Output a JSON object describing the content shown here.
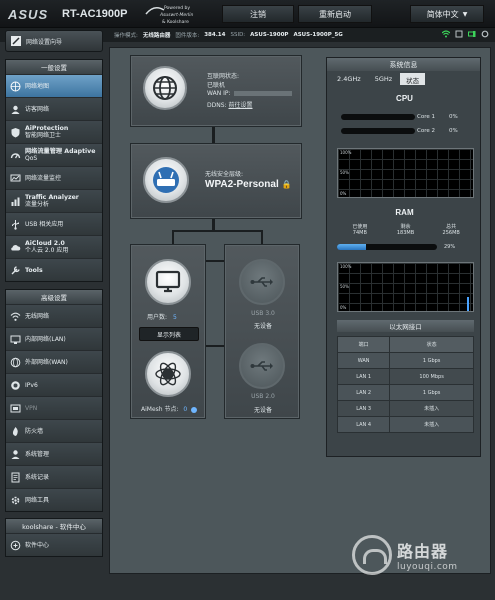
{
  "header": {
    "brand": "ASUS",
    "model": "RT-AC1900P",
    "powered_by": "Powered by Asuswrt-Merlin & Koolshare",
    "logout": "注销",
    "reboot": "重新启动",
    "language": "简体中文"
  },
  "status_bar": {
    "mode_label": "操作模式:",
    "mode_value": "无线路由器",
    "firmware_label": "固件版本:",
    "firmware_value": "384.14",
    "ssid_label": "SSID:",
    "ssid_values": [
      "ASUS-1900P",
      "ASUS-1900P_5G"
    ]
  },
  "sidebar": {
    "quick_setup": "网络设置向导",
    "general_header": "一般设置",
    "general_items": [
      {
        "label": "网络地图",
        "icon": "network-map-icon"
      },
      {
        "label": "访客网络",
        "icon": "guest-network-icon"
      },
      {
        "label": "AiProtection",
        "sub": "智能网络卫士",
        "icon": "aiprotection-icon"
      },
      {
        "label": "网络流量管理 Adaptive",
        "sub": "QoS",
        "icon": "qos-icon"
      },
      {
        "label": "网络流量监控",
        "icon": "traffic-monitor-icon"
      },
      {
        "label": "Traffic Analyzer",
        "sub": "流量分析",
        "icon": "traffic-analyzer-icon"
      },
      {
        "label": "USB 相关应用",
        "icon": "usb-apps-icon"
      },
      {
        "label": "AiCloud 2.0",
        "sub": "个人云 2.0 应用",
        "icon": "aicloud-icon"
      },
      {
        "label": "Tools",
        "icon": "tools-icon"
      }
    ],
    "advanced_header": "高级设置",
    "advanced_items": [
      {
        "label": "无线网络",
        "icon": "wireless-icon"
      },
      {
        "label": "内部网络(LAN)",
        "icon": "lan-icon"
      },
      {
        "label": "外部网络(WAN)",
        "icon": "wan-icon"
      },
      {
        "label": "IPv6",
        "icon": "ipv6-icon"
      },
      {
        "label": "VPN",
        "icon": "vpn-icon"
      },
      {
        "label": "防火墙",
        "icon": "firewall-icon"
      },
      {
        "label": "系统管理",
        "icon": "administration-icon"
      },
      {
        "label": "系统记录",
        "icon": "system-log-icon"
      },
      {
        "label": "网络工具",
        "icon": "network-tools-icon"
      }
    ],
    "koolshare_header": "koolshare - 软件中心",
    "koolshare_item": "软件中心"
  },
  "network_map": {
    "internet_status_label": "互联网状态:",
    "internet_status": "已联机",
    "wan_ip_label": "WAN IP:",
    "ddns_label": "DDNS:",
    "ddns_value": "前往设置",
    "security_label": "无线安全层级:",
    "security_value": "WPA2-Personal",
    "clients_label": "用户数:",
    "clients_count": "5",
    "view_list_button": "显示列表",
    "aimesh_label": "AiMesh 节点:",
    "aimesh_count": "0",
    "usb1_label": "USB 3.0",
    "usb1_status": "无设备",
    "usb2_label": "USB 2.0",
    "usb2_status": "无设备"
  },
  "system_info": {
    "title": "系统信息",
    "tabs": [
      "2.4GHz",
      "5GHz",
      "状态"
    ],
    "active_tab": 2,
    "cpu_title": "CPU",
    "cores": [
      {
        "label": "Core 1",
        "pct": "0%",
        "value": 0
      },
      {
        "label": "Core 2",
        "pct": "0%",
        "value": 0
      }
    ],
    "graph_labels": [
      "100%",
      "50%",
      "0%"
    ],
    "ram_title": "RAM",
    "ram": {
      "used_label": "已使用",
      "used_value": "74MB",
      "free_label": "剩余",
      "free_value": "183MB",
      "total_label": "总共",
      "total_value": "256MB",
      "pct": "29%",
      "value": 0.29
    },
    "ethernet_title": "以太网接口",
    "ethernet_headers": [
      "端口",
      "状态"
    ],
    "ethernet_rows": [
      [
        "WAN",
        "1 Gbps"
      ],
      [
        "LAN 1",
        "100 Mbps"
      ],
      [
        "LAN 2",
        "1 Gbps"
      ],
      [
        "LAN 3",
        "未插入"
      ],
      [
        "LAN 4",
        "未插入"
      ]
    ]
  },
  "watermark": {
    "title": "路由器",
    "url": "luyouqi.com"
  }
}
